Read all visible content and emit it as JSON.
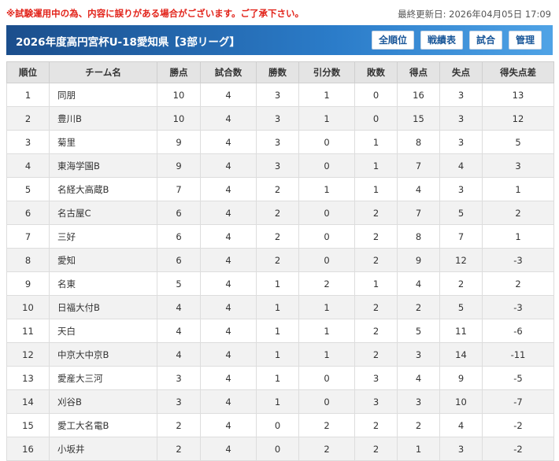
{
  "notice": "※試験運用中の為、内容に誤りがある場合がございます。ご了承下さい。",
  "last_updated": "最終更新日: 2026年04月05日 17:09",
  "header": {
    "title": "2026年度高円宮杯U-18愛知県【3部リーグ】",
    "buttons": [
      "全順位",
      "戦績表",
      "試合",
      "管理"
    ]
  },
  "colors": {
    "notice": "#e2231a",
    "header_bg": "#1b4e8c",
    "header_bg_light": "#4fa3e6"
  },
  "table": {
    "columns": [
      "順位",
      "チーム名",
      "勝点",
      "試合数",
      "勝数",
      "引分数",
      "敗数",
      "得点",
      "失点",
      "得失点差"
    ],
    "rows": [
      [
        "1",
        "同朋",
        "10",
        "4",
        "3",
        "1",
        "0",
        "16",
        "3",
        "13"
      ],
      [
        "2",
        "豊川B",
        "10",
        "4",
        "3",
        "1",
        "0",
        "15",
        "3",
        "12"
      ],
      [
        "3",
        "菊里",
        "9",
        "4",
        "3",
        "0",
        "1",
        "8",
        "3",
        "5"
      ],
      [
        "4",
        "東海学園B",
        "9",
        "4",
        "3",
        "0",
        "1",
        "7",
        "4",
        "3"
      ],
      [
        "5",
        "名経大高蔵B",
        "7",
        "4",
        "2",
        "1",
        "1",
        "4",
        "3",
        "1"
      ],
      [
        "6",
        "名古屋C",
        "6",
        "4",
        "2",
        "0",
        "2",
        "7",
        "5",
        "2"
      ],
      [
        "7",
        "三好",
        "6",
        "4",
        "2",
        "0",
        "2",
        "8",
        "7",
        "1"
      ],
      [
        "8",
        "愛知",
        "6",
        "4",
        "2",
        "0",
        "2",
        "9",
        "12",
        "-3"
      ],
      [
        "9",
        "名東",
        "5",
        "4",
        "1",
        "2",
        "1",
        "4",
        "2",
        "2"
      ],
      [
        "10",
        "日福大付B",
        "4",
        "4",
        "1",
        "1",
        "2",
        "2",
        "5",
        "-3"
      ],
      [
        "11",
        "天白",
        "4",
        "4",
        "1",
        "1",
        "2",
        "5",
        "11",
        "-6"
      ],
      [
        "12",
        "中京大中京B",
        "4",
        "4",
        "1",
        "1",
        "2",
        "3",
        "14",
        "-11"
      ],
      [
        "13",
        "愛産大三河",
        "3",
        "4",
        "1",
        "0",
        "3",
        "4",
        "9",
        "-5"
      ],
      [
        "14",
        "刈谷B",
        "3",
        "4",
        "1",
        "0",
        "3",
        "3",
        "10",
        "-7"
      ],
      [
        "15",
        "愛工大名電B",
        "2",
        "4",
        "0",
        "2",
        "2",
        "2",
        "4",
        "-2"
      ],
      [
        "16",
        "小坂井",
        "2",
        "4",
        "0",
        "2",
        "2",
        "1",
        "3",
        "-2"
      ]
    ]
  }
}
